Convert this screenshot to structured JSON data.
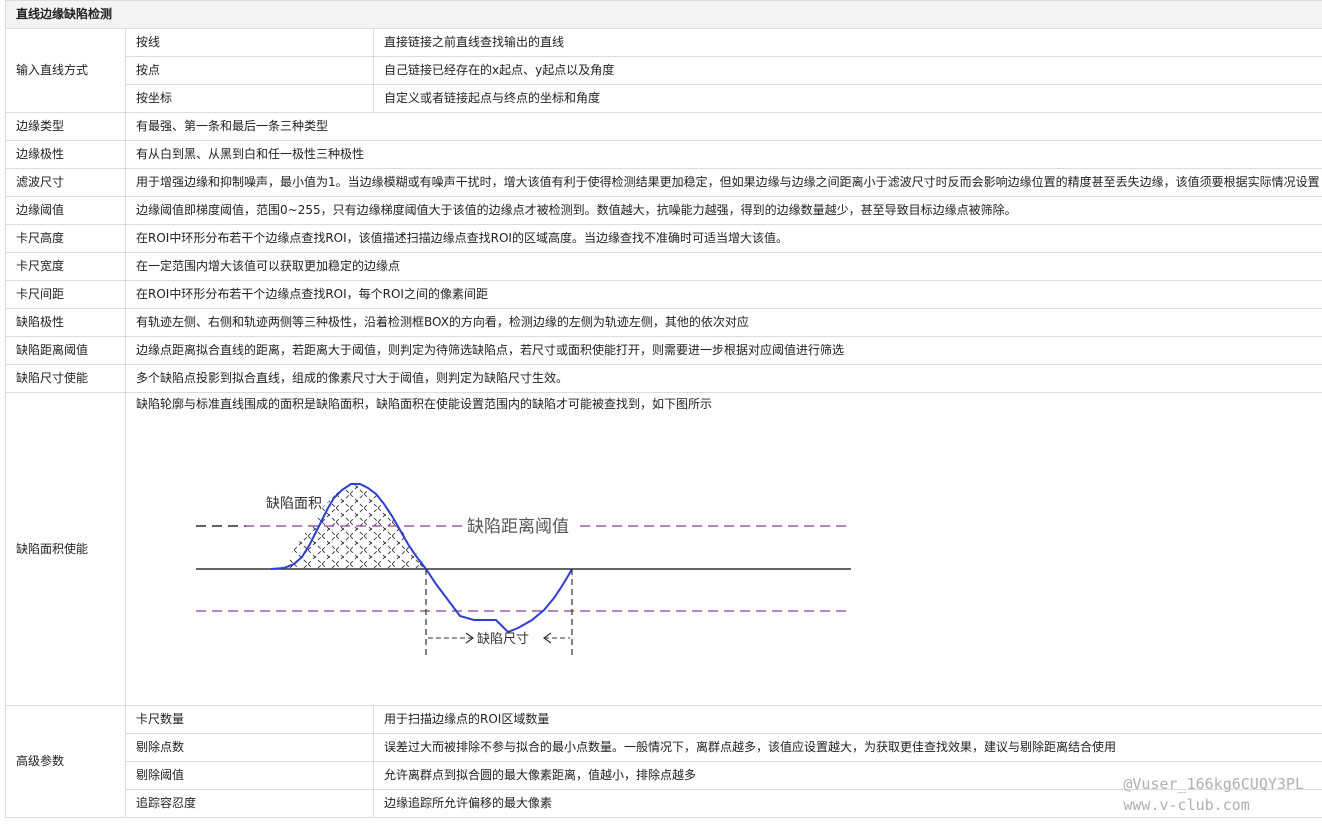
{
  "title": "直线边缘缺陷检测",
  "input_mode": {
    "label": "输入直线方式",
    "options": [
      {
        "name": "按线",
        "desc": "直接链接之前直线查找输出的直线"
      },
      {
        "name": "按点",
        "desc": "自己链接已经存在的x起点、y起点以及角度"
      },
      {
        "name": "按坐标",
        "desc": "自定义或者链接起点与终点的坐标和角度"
      }
    ]
  },
  "params": [
    {
      "name": "边缘类型",
      "desc": "有最强、第一条和最后一条三种类型"
    },
    {
      "name": "边缘极性",
      "desc": "有从白到黑、从黑到白和任一极性三种极性"
    },
    {
      "name": "滤波尺寸",
      "desc": "用于增强边缘和抑制噪声，最小值为1。当边缘模糊或有噪声干扰时，增大该值有利于使得检测结果更加稳定，但如果边缘与边缘之间距离小于滤波尺寸时反而会影响边缘位置的精度甚至丢失边缘，该值须要根据实际情况设置"
    },
    {
      "name": "边缘阈值",
      "desc": "边缘阈值即梯度阈值，范围0~255，只有边缘梯度阈值大于该值的边缘点才被检测到。数值越大，抗噪能力越强，得到的边缘数量越少，甚至导致目标边缘点被筛除。"
    },
    {
      "name": "卡尺高度",
      "desc": "在ROI中环形分布若干个边缘点查找ROI，该值描述扫描边缘点查找ROI的区域高度。当边缘查找不准确时可适当增大该值。"
    },
    {
      "name": "卡尺宽度",
      "desc": "在一定范围内增大该值可以获取更加稳定的边缘点"
    },
    {
      "name": "卡尺间距",
      "desc": "在ROI中环形分布若干个边缘点查找ROI，每个ROI之间的像素间距"
    },
    {
      "name": "缺陷极性",
      "desc": "有轨迹左侧、右侧和轨迹两侧等三种极性，沿着检测框BOX的方向看，检测边缘的左侧为轨迹左侧，其他的依次对应"
    },
    {
      "name": "缺陷距离阈值",
      "desc": "边缘点距离拟合直线的距离，若距离大于阈值，则判定为待筛选缺陷点，若尺寸或面积使能打开，则需要进一步根据对应阈值进行筛选"
    },
    {
      "name": "缺陷尺寸使能",
      "desc": "多个缺陷点投影到拟合直线，组成的像素尺寸大于阈值，则判定为缺陷尺寸生效。"
    }
  ],
  "area": {
    "name": "缺陷面积使能",
    "desc": "缺陷轮廓与标准直线围成的面积是缺陷面积，缺陷面积在使能设置范围内的缺陷才可能被查找到，如下图所示",
    "figure": {
      "label_area": "缺陷面积",
      "label_threshold": "缺陷距离阈值",
      "label_size": "缺陷尺寸",
      "contour_color": "#2b3fd6",
      "threshold_color": "#8a3a9c"
    }
  },
  "advanced": {
    "label": "高级参数",
    "options": [
      {
        "name": "卡尺数量",
        "desc": "用于扫描边缘点的ROI区域数量"
      },
      {
        "name": "剔除点数",
        "desc": "误差过大而被排除不参与拟合的最小点数量。一般情况下，离群点越多，该值应设置越大，为获取更佳查找效果，建议与剔除距离结合使用"
      },
      {
        "name": "剔除阈值",
        "desc": "允许离群点到拟合圆的最大像素距离，值越小，排除点越多"
      },
      {
        "name": "追踪容忍度",
        "desc": "边缘追踪所允许偏移的最大像素"
      }
    ]
  },
  "watermark": {
    "user": "@Vuser_166kg6CUQY3PL",
    "site": "www.v-club.com"
  }
}
